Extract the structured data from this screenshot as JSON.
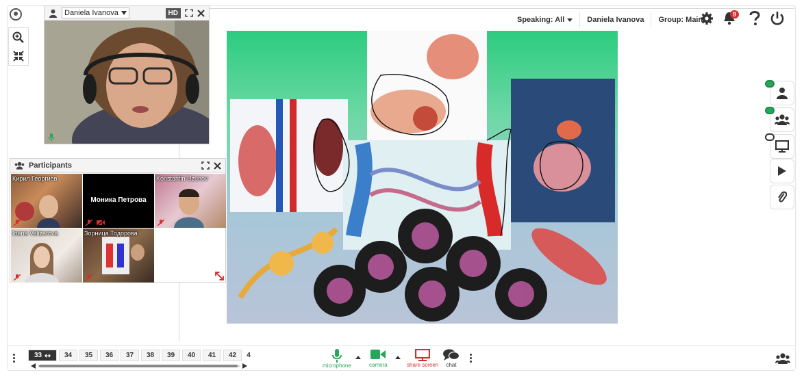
{
  "app": {
    "logo_icon": "app-logo-icon"
  },
  "zoom_tools": [
    {
      "icon": "zoom-in-icon"
    },
    {
      "icon": "fit-screen-icon"
    }
  ],
  "video": {
    "user_select": "Daniela Ivanova",
    "hd_label": "HD",
    "expand_icon": "expand-icon",
    "close_icon": "close-icon"
  },
  "participants": {
    "title": "Participants",
    "tiles": [
      {
        "name": "Кирил Георгиев",
        "muted": true
      },
      {
        "name": "Моника Петрова",
        "muted": true,
        "camera_off": true
      },
      {
        "name": "Konstantin Uzunov",
        "muted": true
      },
      {
        "name": "Ioana Velizarova",
        "muted": true
      },
      {
        "name": "Зорница Тодорова",
        "muted": true
      }
    ]
  },
  "header": {
    "speaking": "Speaking: All",
    "user": "Daniela Ivanova",
    "group": "Group: Main",
    "notifications_count": "9",
    "icons": [
      "settings-icon",
      "bell-icon",
      "help-icon",
      "power-icon"
    ]
  },
  "right_dock": [
    "user-icon",
    "users-icon",
    "screen-icon",
    "play-icon",
    "paperclip-icon"
  ],
  "pagination": {
    "current": "33",
    "pages": [
      "34",
      "35",
      "36",
      "37",
      "38",
      "39",
      "40",
      "41",
      "42",
      "4"
    ],
    "scroll_fraction": 0.93
  },
  "media_controls": {
    "microphone": "microphone",
    "camera": "camera",
    "share_screen": "share screen",
    "chat": "chat",
    "colors": {
      "microphone": "#26a65b",
      "camera": "#26a65b",
      "share_screen": "#d32f2f",
      "chat": "#333333"
    }
  }
}
